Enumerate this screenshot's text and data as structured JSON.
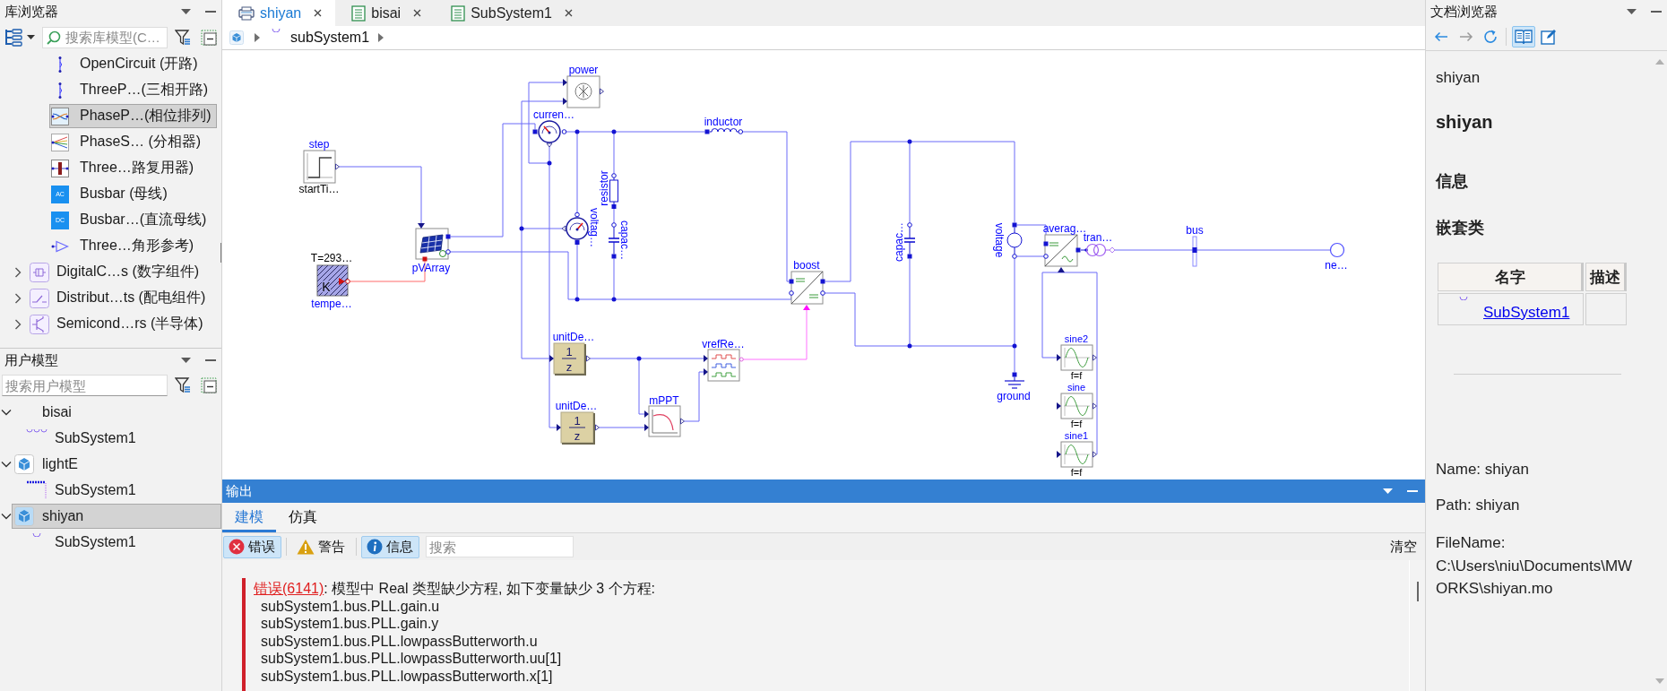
{
  "library_browser": {
    "title": "库浏览器",
    "search": {
      "placeholder": "搜索库模型(C…"
    },
    "tree": [
      {
        "children": [
          {
            "label": "OpenCircuit (开路)",
            "kind": "open-circuit",
            "selected": false
          },
          {
            "label": "ThreeP…(三相开路)",
            "kind": "three-phase-open",
            "selected": false
          },
          {
            "label": "PhaseP…(相位排列)",
            "kind": "phase-permutation",
            "selected": true
          },
          {
            "label": "PhaseS… (分相器)",
            "kind": "phase-splitter",
            "selected": false
          },
          {
            "label": "Three…路复用器)",
            "kind": "multiplexer",
            "selected": false
          },
          {
            "label": "Busbar (母线)",
            "kind": "busbar",
            "icon_text": "AC",
            "selected": false
          },
          {
            "label": "Busbar…(直流母线)",
            "kind": "busbar",
            "icon_text": "DC",
            "selected": false
          },
          {
            "label": "Three…角形参考)",
            "kind": "triangle",
            "selected": false
          }
        ]
      },
      {
        "label": "DigitalC…s (数字组件)",
        "kind": "digital",
        "expanded": false,
        "selected": false
      },
      {
        "label": "Distribut…ts (配电组件)",
        "kind": "distribution",
        "expanded": false,
        "selected": false
      },
      {
        "label": "Semicond…rs (半导体)",
        "kind": "semiconductor",
        "expanded": false,
        "selected": false
      }
    ]
  },
  "user_models": {
    "title": "用户模型",
    "search": {
      "placeholder": "搜索用户模型"
    },
    "tree": [
      {
        "label": "bisai",
        "kind": "unloaded",
        "expanded": true,
        "selected": false,
        "children": [
          {
            "label": "SubSystem1",
            "kind": "arcs",
            "selected": false
          }
        ]
      },
      {
        "label": "lightE",
        "kind": "package",
        "expanded": true,
        "selected": false,
        "children": [
          {
            "label": "SubSystem1",
            "kind": "bracket",
            "selected": false
          }
        ]
      },
      {
        "label": "shiyan",
        "kind": "package",
        "expanded": true,
        "selected": true,
        "children": [
          {
            "label": "SubSystem1",
            "kind": "arc",
            "selected": false
          }
        ]
      }
    ]
  },
  "editor": {
    "tabs": [
      {
        "label": "shiyan",
        "kind": "diagram",
        "selected": true
      },
      {
        "label": "bisai",
        "kind": "text",
        "selected": false
      },
      {
        "label": "SubSystem1",
        "kind": "text",
        "selected": false
      }
    ],
    "breadcrumb": [
      {
        "label": "subSystem1"
      }
    ],
    "diagram": {
      "components": [
        {
          "kind": "step",
          "label": "step",
          "parameter": "startTi…"
        },
        {
          "kind": "pv-array",
          "label": "pVArray"
        },
        {
          "kind": "temperature",
          "label": "tempe…",
          "parameter": "T=293…",
          "symbol": "K"
        },
        {
          "kind": "power-sensor",
          "label": "power"
        },
        {
          "kind": "current-sensor",
          "label": "curren…"
        },
        {
          "kind": "voltage-sensor",
          "label": "voltag…"
        },
        {
          "kind": "inductor",
          "label": "inductor"
        },
        {
          "kind": "resistor",
          "label": "resistor"
        },
        {
          "kind": "capacitor",
          "label": "capac…"
        },
        {
          "kind": "unit-delay",
          "label": "unitDe…",
          "numerator": "1",
          "denominator": "z"
        },
        {
          "kind": "unit-delay",
          "label": "unitDe…",
          "numerator": "1",
          "denominator": "z"
        },
        {
          "kind": "mppt",
          "label": "mPPT"
        },
        {
          "kind": "pwm",
          "label": "vrefRe…"
        },
        {
          "kind": "converter",
          "label": "boost"
        },
        {
          "kind": "capacitor",
          "label": "capac…"
        },
        {
          "kind": "voltage-source",
          "label": "voltage"
        },
        {
          "kind": "ground",
          "label": "ground"
        },
        {
          "kind": "inverter",
          "label": "averag…"
        },
        {
          "kind": "transformer",
          "label": "tran…"
        },
        {
          "kind": "bus",
          "label": "bus"
        },
        {
          "kind": "grid",
          "label": "ne…"
        },
        {
          "kind": "sine",
          "label": "sine2",
          "parameter": "f=f"
        },
        {
          "kind": "sine",
          "label": "sine",
          "parameter": "f=f"
        },
        {
          "kind": "sine",
          "label": "sine1",
          "parameter": "f=f"
        }
      ]
    }
  },
  "output": {
    "title": "输出",
    "tabs": [
      {
        "label": "建模",
        "selected": true
      },
      {
        "label": "仿真",
        "selected": false
      }
    ],
    "filters": [
      {
        "kind": "error",
        "label": "错误",
        "checked": true
      },
      {
        "kind": "warning",
        "label": "警告",
        "checked": false
      },
      {
        "kind": "info",
        "label": "信息",
        "checked": true
      }
    ],
    "search": {
      "placeholder": "搜索"
    },
    "clear_button": "清空",
    "messages": [
      {
        "kind": "error",
        "link": "错误(6141)",
        "text": ": 模型中 Real 类型缺少方程, 如下变量缺少 3 个方程:",
        "details": [
          "subSystem1.bus.PLL.gain.u",
          "subSystem1.bus.PLL.gain.y",
          "subSystem1.bus.PLL.lowpassButterworth.u",
          "subSystem1.bus.PLL.lowpassButterworth.uu[1]",
          "subSystem1.bus.PLL.lowpassButterworth.x[1]"
        ]
      }
    ]
  },
  "documentation_browser": {
    "title": "文档浏览器",
    "toolbar": [
      {
        "kind": "back",
        "disabled": false
      },
      {
        "kind": "forward",
        "disabled": true
      },
      {
        "kind": "refresh",
        "disabled": false
      },
      {
        "kind": "view",
        "selected": true
      },
      {
        "kind": "edit",
        "selected": false
      }
    ],
    "path": "shiyan",
    "heading": "shiyan",
    "sections": [
      {
        "title": "信息"
      },
      {
        "title": "嵌套类",
        "table": {
          "columns": [
            "名字",
            "描述"
          ],
          "rows": [
            {
              "name": "SubSystem1"
            }
          ]
        }
      }
    ],
    "properties": [
      "Name: shiyan",
      "Path: shiyan",
      "FileName: C:\\Users\\niu\\Documents\\MWORKS\\shiyan.mo"
    ]
  }
}
